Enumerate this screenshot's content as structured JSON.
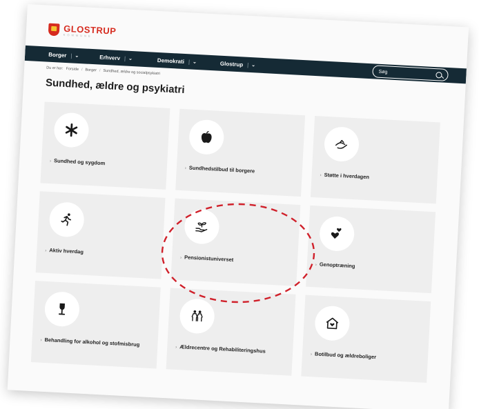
{
  "header": {
    "logo_name": "GLOSTRUP",
    "logo_sub": "KOMMUNE"
  },
  "nav": {
    "items": [
      {
        "label": "Borger"
      },
      {
        "label": "Erhverv"
      },
      {
        "label": "Demokrati"
      },
      {
        "label": "Glostrup"
      }
    ],
    "search_placeholder": "Søg"
  },
  "breadcrumb": {
    "prefix": "Du er her:",
    "items": [
      "Forside",
      "Borger",
      "Sundhed, ældre og socialpsykiatri"
    ]
  },
  "page_title": "Sundhed, ældre og psykiatri",
  "tiles": [
    {
      "label": "Sundhed og sygdom",
      "icon": "asterisk-icon"
    },
    {
      "label": "Sundhedstilbud til borgere",
      "icon": "apple-icon"
    },
    {
      "label": "Støtte i hverdagen",
      "icon": "helping-hand-icon"
    },
    {
      "label": "Aktiv hverdag",
      "icon": "running-person-icon"
    },
    {
      "label": "Pensionistuniverset",
      "icon": "plant-in-hand-icon"
    },
    {
      "label": "Genoptræning",
      "icon": "hearts-icon"
    },
    {
      "label": "Behandling for alkohol og stofmisbrug",
      "icon": "wine-glass-icon"
    },
    {
      "label": "Ældrecentre og Rehabiliteringshus",
      "icon": "elderly-couple-icon"
    },
    {
      "label": "Botilbud og ældreboliger",
      "icon": "house-heart-icon"
    }
  ],
  "colors": {
    "nav_bg": "#152a35",
    "brand_red": "#d62b1f",
    "tile_bg": "#eeeeee",
    "annotation": "#d0202a"
  }
}
